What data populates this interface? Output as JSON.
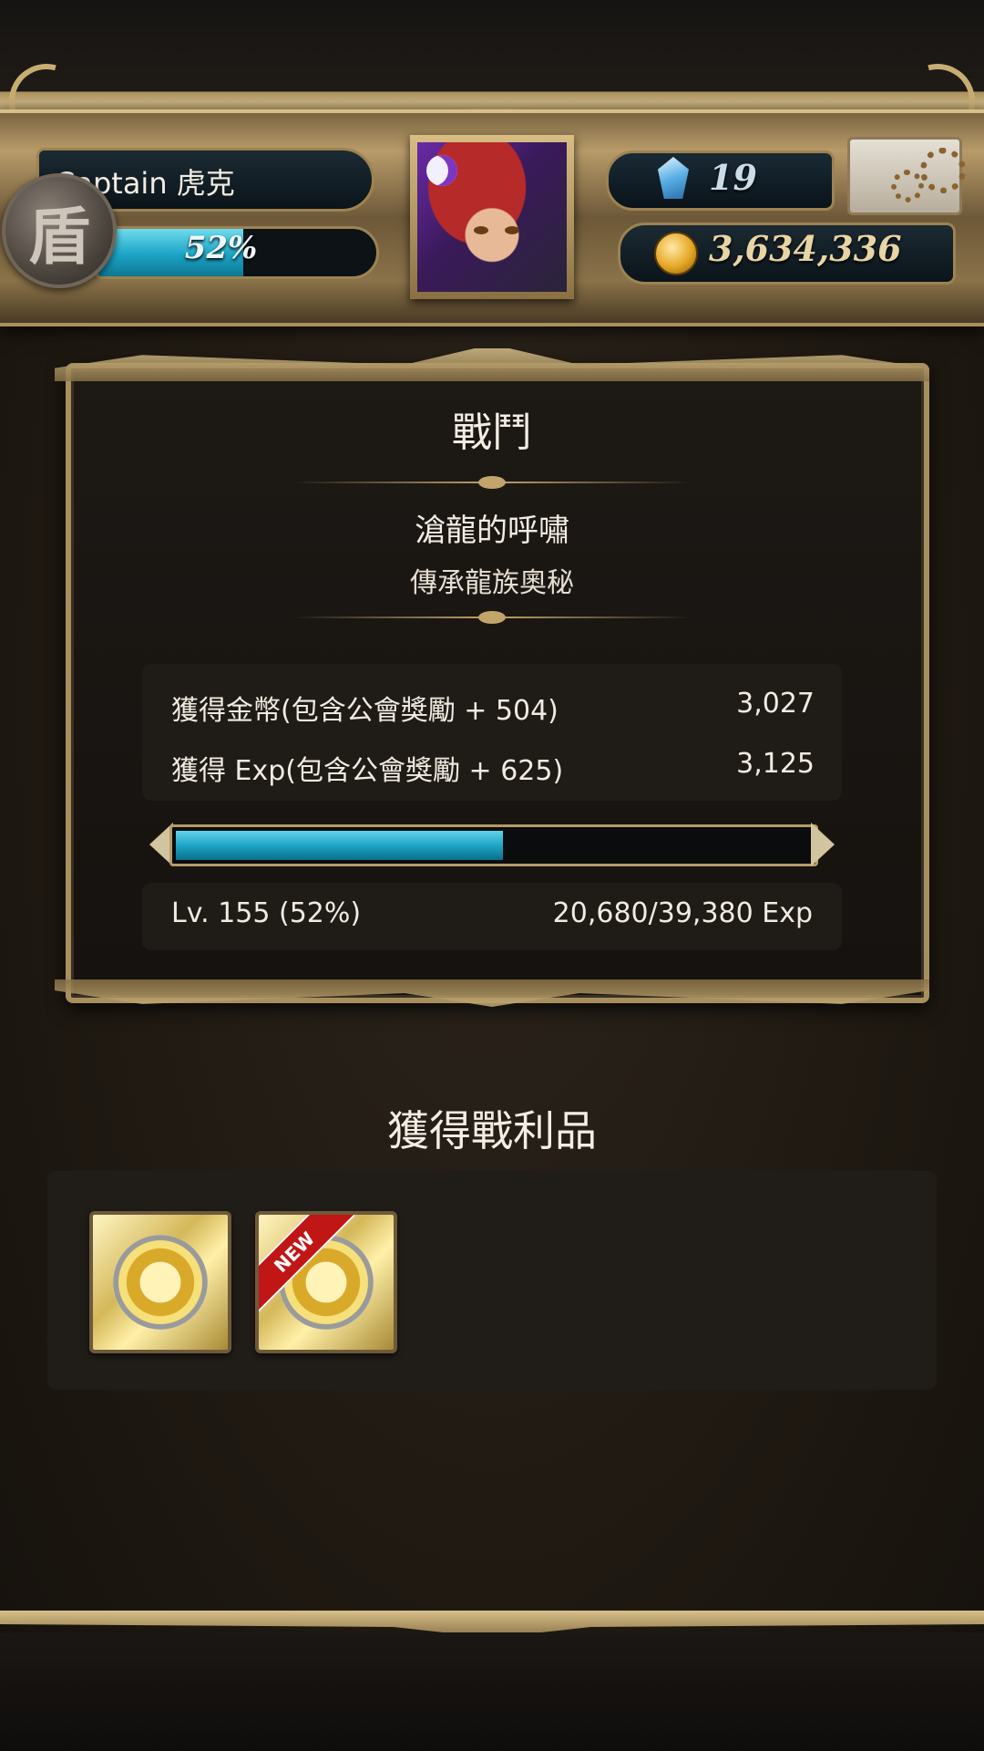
{
  "player": {
    "name": "Captain 虎克",
    "exp_percent_label": "52%",
    "exp_fraction": 0.52,
    "rank_glyph": "盾"
  },
  "currency": {
    "gems": "19",
    "coins": "3,634,336"
  },
  "battle": {
    "title": "戰鬥",
    "quest_name": "滄龍的呼嘯",
    "quest_subtitle": "傳承龍族奧秘",
    "rewards": [
      {
        "label": "獲得金幣(包含公會獎勵 + 504)",
        "value": "3,027"
      },
      {
        "label": "獲得 Exp(包含公會獎勵 + 625)",
        "value": "3,125"
      }
    ],
    "level_fraction": 0.52,
    "level_label": "Lv. 155 (52%)",
    "exp_progress": "20,680/39,380 Exp"
  },
  "loot": {
    "title": "獲得戰利品",
    "items": [
      {
        "icon": "gold-medal-card-icon",
        "badge": ""
      },
      {
        "icon": "gold-medal-card-icon",
        "badge": "NEW"
      }
    ]
  },
  "icons": {
    "gem": "blue-crystal-icon",
    "coin": "gold-coin-icon",
    "settings": "gear-icon"
  },
  "colors": {
    "exp_bar": "#1aa3c4",
    "frame_gold": "#a88f5e",
    "new_ribbon": "#c11616"
  }
}
